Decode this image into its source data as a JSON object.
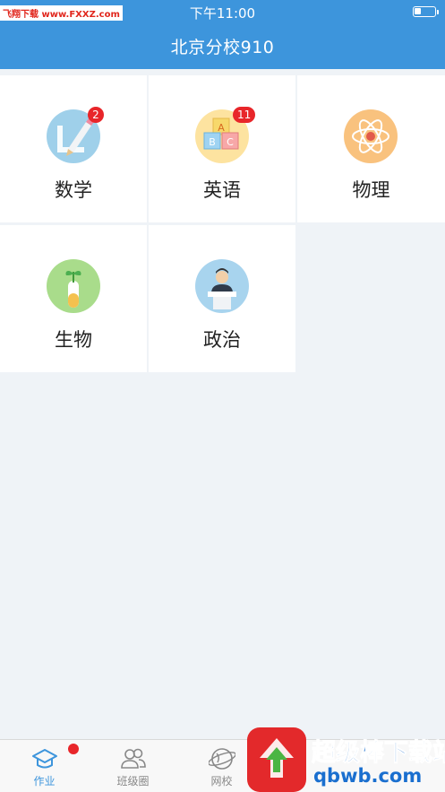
{
  "status_bar": {
    "time": "下午11:00",
    "watermark": "飞翔下载 www.FXXZ.com"
  },
  "header": {
    "title": "北京分校910"
  },
  "subjects": [
    {
      "label": "数学",
      "icon": "math-ruler-pencil-icon",
      "badge": "2"
    },
    {
      "label": "英语",
      "icon": "abc-blocks-icon",
      "badge": "11"
    },
    {
      "label": "物理",
      "icon": "atom-icon",
      "badge": ""
    },
    {
      "label": "生物",
      "icon": "plant-test-tube-icon",
      "badge": ""
    },
    {
      "label": "政治",
      "icon": "speaker-podium-icon",
      "badge": ""
    }
  ],
  "tabbar": {
    "tabs": [
      {
        "label": "作业",
        "icon": "homework-hat-icon",
        "active": true,
        "dot": true
      },
      {
        "label": "班级圈",
        "icon": "class-circle-people-icon",
        "active": false,
        "dot": false
      },
      {
        "label": "网校",
        "icon": "globe-icon",
        "active": false,
        "dot": false
      }
    ]
  },
  "brand_watermark": {
    "name": "超级棒下载站",
    "url": "qbwb.com"
  },
  "colors": {
    "accent": "#3d95dc",
    "badge": "#e8262a",
    "background": "#eff3f7"
  }
}
